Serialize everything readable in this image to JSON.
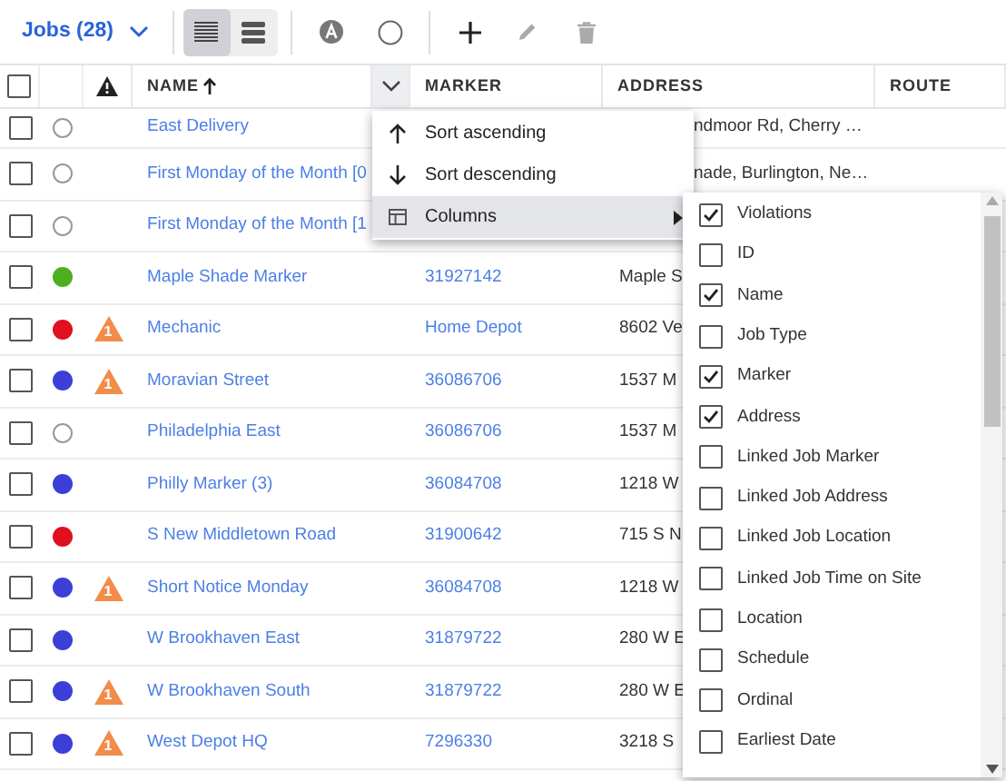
{
  "toolbar": {
    "title": "Jobs (28)",
    "views": [
      {
        "kind": "list",
        "selected": true
      },
      {
        "kind": "cards",
        "selected": false
      }
    ],
    "actions": [
      {
        "kind": "add",
        "disabled": false
      },
      {
        "kind": "edit",
        "disabled": true
      },
      {
        "kind": "delete",
        "disabled": true
      }
    ]
  },
  "table": {
    "select_all": {
      "checked": false
    },
    "columns": [
      {
        "kind": "warning"
      },
      {
        "kind": "text",
        "label": "NAME",
        "sorted_ascending": true
      },
      {
        "kind": "menu"
      },
      {
        "kind": "text",
        "label": "MARKER"
      },
      {
        "kind": "text",
        "label": "ADDRESS"
      },
      {
        "kind": "text",
        "label": "ROUTE"
      }
    ],
    "rows": [
      {
        "checked": false,
        "name": "East Delivery",
        "address": "ndmoor Rd, Cherry …"
      },
      {
        "checked": false,
        "name": "First Monday of the Month [0",
        "address": "nade, Burlington, Ne…"
      },
      {
        "checked": false,
        "name": "First Monday of the Month [1"
      },
      {
        "checked": false,
        "color": "#4caf1f",
        "name": "Maple Shade Marker",
        "marker": "31927142",
        "address": "Maple S"
      },
      {
        "checked": false,
        "color": "#e0101e",
        "violations": "1",
        "name": "Mechanic",
        "marker": "Home Depot",
        "address": "8602 Ve"
      },
      {
        "checked": false,
        "color": "#3b3fd8",
        "violations": "1",
        "name": "Moravian Street",
        "marker": "36086706",
        "address": "1537 M"
      },
      {
        "checked": false,
        "name": "Philadelphia East",
        "marker": "36086706",
        "address": "1537 M"
      },
      {
        "checked": false,
        "color": "#3b3fd8",
        "name": "Philly Marker (3)",
        "marker": "36084708",
        "address": "1218 W"
      },
      {
        "checked": false,
        "color": "#e0101e",
        "name": "S New Middletown Road",
        "marker": "31900642",
        "address": "715 S N"
      },
      {
        "checked": false,
        "color": "#3b3fd8",
        "violations": "1",
        "name": "Short Notice Monday",
        "marker": "36084708",
        "address": "1218 W"
      },
      {
        "checked": false,
        "color": "#3b3fd8",
        "name": "W Brookhaven East",
        "marker": "31879722",
        "address": "280 W E"
      },
      {
        "checked": false,
        "color": "#3b3fd8",
        "violations": "1",
        "name": "W Brookhaven South",
        "marker": "31879722",
        "address": "280 W E"
      },
      {
        "checked": false,
        "color": "#3b3fd8",
        "violations": "1",
        "name": "West Depot HQ",
        "marker": "7296330",
        "address": "3218 S"
      }
    ]
  },
  "column_menu": {
    "items": [
      {
        "kind": "up",
        "label": "Sort ascending",
        "selected": false
      },
      {
        "kind": "down",
        "label": "Sort descending",
        "selected": false
      },
      {
        "kind": "columns",
        "label": "Columns",
        "selected": true
      }
    ]
  },
  "columns_submenu": {
    "items": [
      {
        "label": "Violations",
        "checked": true
      },
      {
        "label": "ID",
        "checked": false
      },
      {
        "label": "Name",
        "checked": true
      },
      {
        "label": "Job Type",
        "checked": false
      },
      {
        "label": "Marker",
        "checked": true
      },
      {
        "label": "Address",
        "checked": true
      },
      {
        "label": "Linked Job Marker",
        "checked": false
      },
      {
        "label": "Linked Job Address",
        "checked": false
      },
      {
        "label": "Linked Job Location",
        "checked": false
      },
      {
        "label": "Linked Job Time on Site",
        "checked": false
      },
      {
        "label": "Location",
        "checked": false
      },
      {
        "label": "Schedule",
        "checked": false
      },
      {
        "label": "Ordinal",
        "checked": false
      },
      {
        "label": "Earliest Date",
        "checked": false
      }
    ]
  }
}
